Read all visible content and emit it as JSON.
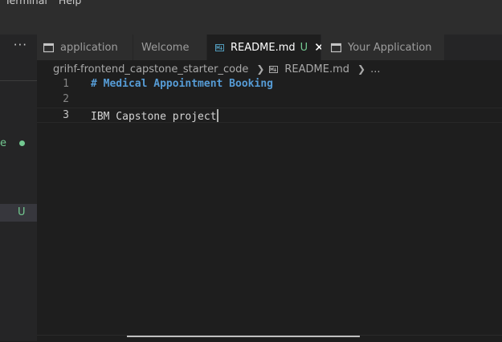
{
  "menubar": {
    "items": [
      "Terminal",
      "Help"
    ]
  },
  "sidebar": {
    "more_label": "···",
    "rows": [
      {
        "letter": "e",
        "status": "dot"
      },
      {
        "badge": "U"
      }
    ]
  },
  "tabs": [
    {
      "label": "application",
      "icon": "window-icon",
      "active": false
    },
    {
      "label": "Welcome",
      "icon": "",
      "active": false
    },
    {
      "label": "README.md",
      "icon": "markdown-icon",
      "active": true,
      "status": "U",
      "close": "✕"
    },
    {
      "label": "Your Application",
      "icon": "window-icon",
      "active": false
    }
  ],
  "breadcrumb": {
    "folder": "grihf-frontend_capstone_starter_code",
    "file": "README.md",
    "more": "..."
  },
  "editor": {
    "lines": [
      {
        "num": "1",
        "text": "# Medical Appointment Booking"
      },
      {
        "num": "2",
        "text": ""
      },
      {
        "num": "3",
        "text": "IBM Capstone project"
      }
    ]
  },
  "colors": {
    "accent_green": "#73c991",
    "heading_blue": "#569cd6",
    "editor_bg": "#1e1e1e"
  }
}
